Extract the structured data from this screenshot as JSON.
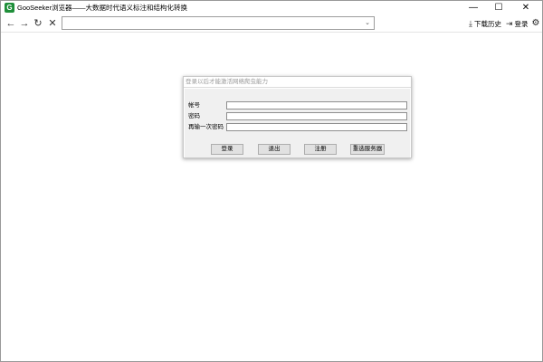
{
  "window": {
    "title": "GooSeeker浏览器——大数据时代语义标注和结构化转换",
    "app_icon_letter": "G",
    "minimize_icon": "—",
    "maximize_icon": "☐",
    "close_icon": "✕"
  },
  "toolbar": {
    "back_icon": "←",
    "forward_icon": "→",
    "refresh_icon": "↻",
    "stop_icon": "✕",
    "address_value": "",
    "address_dropdown_icon": "⌄",
    "download_icon": "⤓",
    "download_label": "下载历史",
    "login_icon": "⇥",
    "login_label": "登录",
    "settings_icon": "⚙"
  },
  "dialog": {
    "header": "登录以后才能激活网络爬虫能力",
    "fields": [
      {
        "label": "帐号",
        "value": ""
      },
      {
        "label": "密码",
        "value": ""
      },
      {
        "label": "再输一次密码",
        "value": ""
      }
    ],
    "buttons": {
      "login": "登录",
      "logout": "退出",
      "register": "注册",
      "select_server": "重选服务器"
    }
  },
  "colors": {
    "app_icon": "#1f8f3a",
    "dialog_panel": "#f0f0f0",
    "button_bg": "#e1e1e1"
  }
}
